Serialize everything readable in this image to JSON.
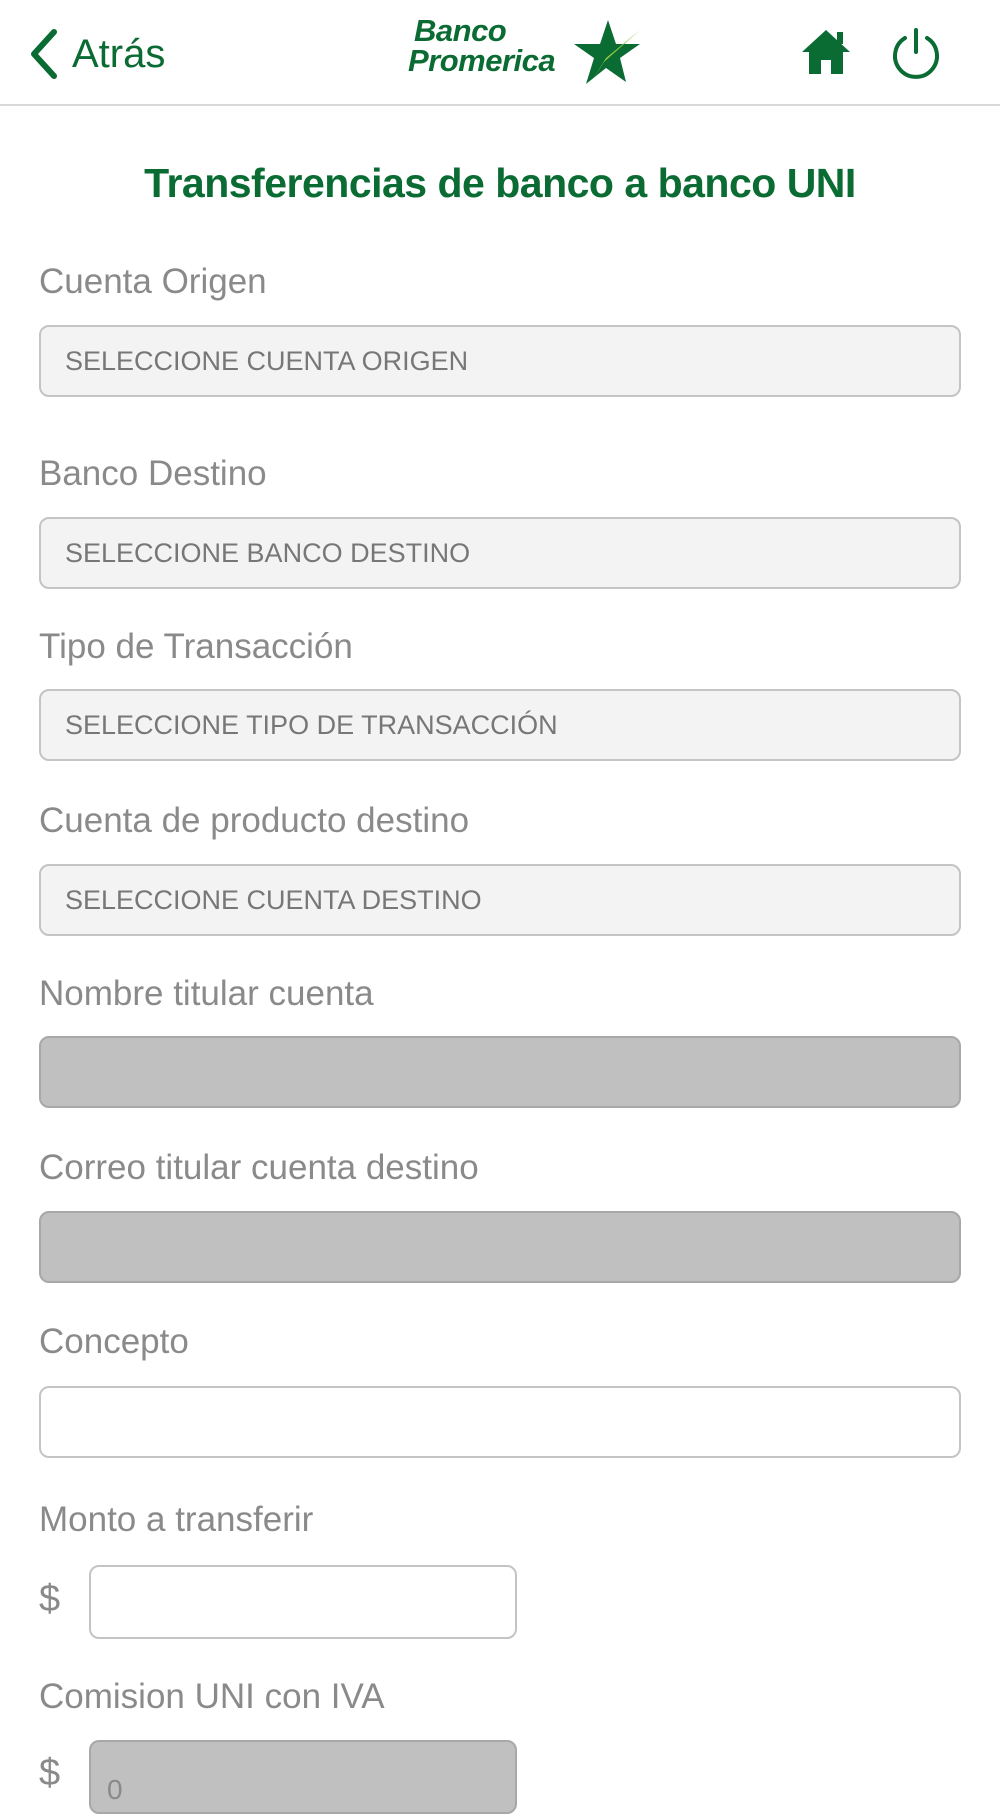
{
  "header": {
    "back_label": "Atrás",
    "logo_line1": "Banco",
    "logo_line2": "Promerica",
    "home_icon": "home-icon",
    "power_icon": "power-icon"
  },
  "page": {
    "title": "Transferencias de banco a banco UNI"
  },
  "form": {
    "cuenta_origen": {
      "label": "Cuenta Origen",
      "value": "SELECCIONE CUENTA ORIGEN"
    },
    "banco_destino": {
      "label": "Banco Destino",
      "value": "SELECCIONE BANCO DESTINO"
    },
    "tipo_transaccion": {
      "label": "Tipo de Transacción",
      "value": "SELECCIONE TIPO DE TRANSACCIÓN"
    },
    "cuenta_destino": {
      "label": "Cuenta de producto destino",
      "value": "SELECCIONE CUENTA DESTINO"
    },
    "nombre_titular": {
      "label": "Nombre titular cuenta",
      "value": ""
    },
    "correo_titular": {
      "label": "Correo titular cuenta destino",
      "value": ""
    },
    "concepto": {
      "label": "Concepto",
      "value": ""
    },
    "monto": {
      "label": "Monto a transferir",
      "currency": "$",
      "value": ""
    },
    "comision": {
      "label": "Comision UNI con IVA",
      "currency": "$",
      "value": "0"
    }
  },
  "colors": {
    "brand_green": "#0a6b33",
    "accent_lime": "#8cc63f"
  }
}
